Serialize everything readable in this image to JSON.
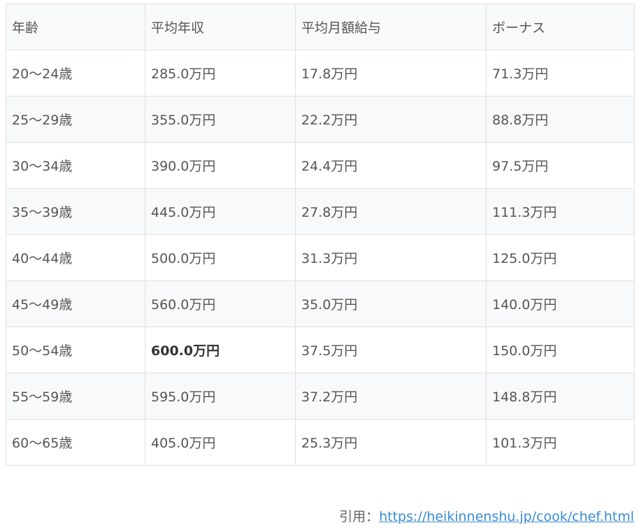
{
  "table": {
    "headers": [
      "年齢",
      "平均年収",
      "平均月額給与",
      "ボーナス"
    ],
    "rows": [
      [
        "20〜24歳",
        "285.0万円",
        "17.8万円",
        "71.3万円"
      ],
      [
        "25〜29歳",
        "355.0万円",
        "22.2万円",
        "88.8万円"
      ],
      [
        "30〜34歳",
        "390.0万円",
        "24.4万円",
        "97.5万円"
      ],
      [
        "35〜39歳",
        "445.0万円",
        "27.8万円",
        "111.3万円"
      ],
      [
        "40〜44歳",
        "500.0万円",
        "31.3万円",
        "125.0万円"
      ],
      [
        "45〜49歳",
        "560.0万円",
        "35.0万円",
        "140.0万円"
      ],
      [
        "50〜54歳",
        "600.0万円",
        "37.5万円",
        "150.0万円"
      ],
      [
        "55〜59歳",
        "595.0万円",
        "37.2万円",
        "148.8万円"
      ],
      [
        "60〜65歳",
        "405.0万円",
        "25.3万円",
        "101.3万円"
      ]
    ]
  },
  "citation": {
    "label": "引用：",
    "link_text": "https://heikinnenshu.jp/cook/chef.html"
  }
}
